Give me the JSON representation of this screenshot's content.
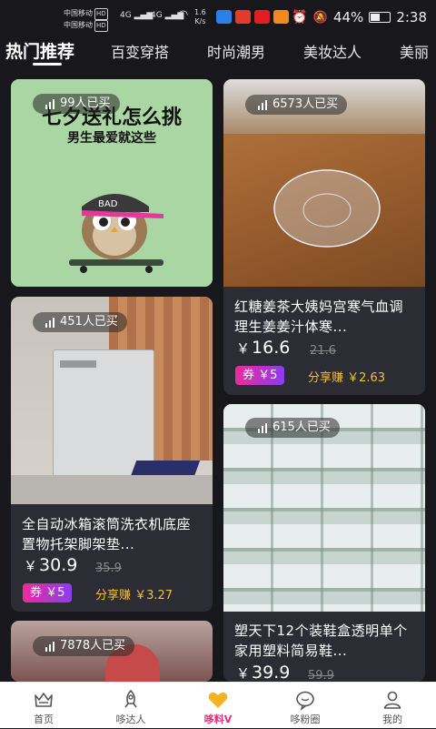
{
  "status": {
    "carrier1": "中国移动",
    "carrier2": "中国移动",
    "hd": "HD",
    "net1": "4G",
    "net2": "4G",
    "speed_val": "1.6",
    "speed_unit": "K/s",
    "battery": "44%",
    "time": "2:38",
    "battery_level": 0.44
  },
  "tabs": [
    {
      "label": "热门推荐"
    },
    {
      "label": "百变穿搭"
    },
    {
      "label": "时尚潮男"
    },
    {
      "label": "美妆达人"
    },
    {
      "label": "美丽"
    }
  ],
  "cards": [
    {
      "bought": "99人已买",
      "poster_title": "七夕送礼怎么挑",
      "poster_subtitle": "男生最爱就这些",
      "cap_text": "BAD"
    },
    {
      "bought": "6573人已买",
      "title": "红糖姜茶大姨妈宫寒气血调理生姜姜汁体寒...",
      "price": "16.6",
      "orig": "21.6",
      "coupon": "券 ￥5",
      "share": "分享赚 ￥2.63"
    },
    {
      "bought": "451人已买",
      "title": "全自动冰箱滚筒洗衣机底座置物托架脚架垫...",
      "price": "30.9",
      "orig": "35.9",
      "coupon": "券 ￥5",
      "share": "分享赚 ￥3.27"
    },
    {
      "bought": "615人已买",
      "title": "塑天下12个装鞋盒透明单个家用塑料简易鞋...",
      "price": "39.9",
      "orig": "59.9"
    },
    {
      "bought": "7878人已买"
    }
  ],
  "currency": "￥",
  "nav": [
    {
      "label": "首页",
      "icon": "crown-icon"
    },
    {
      "label": "哆达人",
      "icon": "rocket-icon"
    },
    {
      "label": "哆料V",
      "icon": "heart-icon"
    },
    {
      "label": "哆粉圈",
      "icon": "chat-bubble-icon"
    },
    {
      "label": "我的",
      "icon": "user-icon"
    }
  ],
  "colors": {
    "background": "#17171c",
    "card": "#2c2c34",
    "share": "#f3c133",
    "coupon_start": "#f02a9a",
    "coupon_end": "#8b3cf0",
    "nav_active": "#e52b7a",
    "heart": "#f5b324"
  }
}
